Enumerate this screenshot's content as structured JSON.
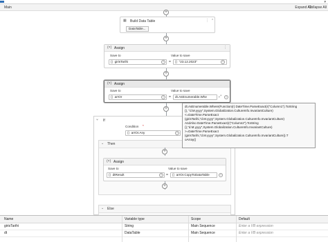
{
  "breadcrumb": "Main",
  "toolbar": {
    "expand_all": "Expand All",
    "collapse_all": "Collapse All"
  },
  "build_table": {
    "title": "Build Data Table",
    "button": "DataTable..."
  },
  "assign1": {
    "title": "Assign",
    "to_label": "Save to",
    "value_label": "Value to save",
    "to": "girisTarihi",
    "value": "\"23.12.2023\""
  },
  "assign2": {
    "title": "Assign",
    "to_label": "Save to",
    "value_label": "Value to save",
    "to": "arrOr",
    "value": "dt.AsEnumerable.Whe"
  },
  "tooltip": "dt.AsEnumerable.Where(Function(r) DateTime.ParseExact(r(\"Column1\").ToString\n(), \"d.M.yyyy\",System.Globalization.CultureInfo.InvariantCulture)\n<=DateTime.ParseExact\n(girisTarihi,\"d.M.yyyy\",System.Globalization.CultureInfo.InvariantCulture)\nAndAlso DateTime.ParseExact(r(\"Column2\").ToString\n(),\"d.M.yyyy\",System.Globalization.CultureInfo.InvariantCulture)\n>=DateTime.ParseExact\n(girisTarihi,\"d.M.yyyy\",System.Globalization.CultureInfo.InvariantCulture)).T\noArray()",
  "if_block": {
    "title": "If",
    "condition_label": "Condition",
    "condition": "arrOr.Any"
  },
  "then_branch": {
    "title": "Then"
  },
  "assign3": {
    "title": "Assign",
    "to_label": "Save to",
    "value_label": "Value to save",
    "to": "dtResult",
    "value": "arrOr.CopyToDataTable"
  },
  "else_branch": {
    "title": "Else"
  },
  "variables": {
    "headers": {
      "name": "Name",
      "type": "Variable type",
      "scope": "Scope",
      "default": "Default"
    },
    "rows": [
      {
        "name": "girisTarihi",
        "type": "String",
        "scope": "Main Sequence",
        "default": "Enter a VB expression"
      },
      {
        "name": "dt",
        "type": "DataTable",
        "scope": "Main Sequence",
        "default": "Enter a VB expression"
      }
    ]
  }
}
